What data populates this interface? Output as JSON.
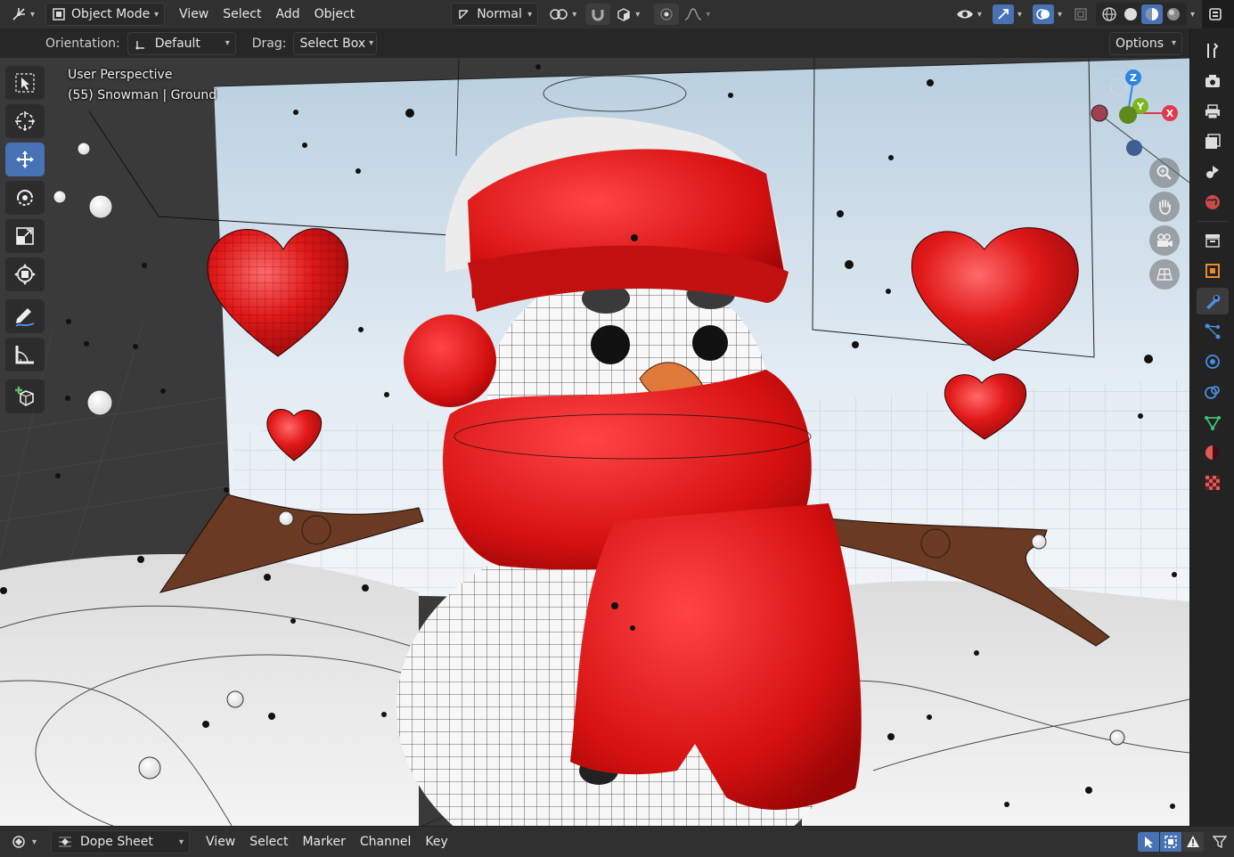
{
  "header": {
    "mode_label": "Object Mode",
    "menus": [
      "View",
      "Select",
      "Add",
      "Object"
    ],
    "transform_orientation": "Normal"
  },
  "tool_options": {
    "orientation_label": "Orientation:",
    "orientation_value": "Default",
    "drag_label": "Drag:",
    "drag_value": "Select Box",
    "options_label": "Options"
  },
  "viewport": {
    "perspective_label": "User Perspective",
    "object_info": "(55) Snowman | Ground",
    "gizmo": {
      "z": "Z",
      "y": "Y",
      "x": "X"
    }
  },
  "footer": {
    "editor_type": "Dope Sheet",
    "menus": [
      "View",
      "Select",
      "Marker",
      "Channel",
      "Key"
    ]
  },
  "colors": {
    "accent": "#4772b3",
    "header_bg": "#303030",
    "axis_x": "#e0394f",
    "axis_y": "#7ab71e",
    "axis_z": "#2f84e0"
  }
}
